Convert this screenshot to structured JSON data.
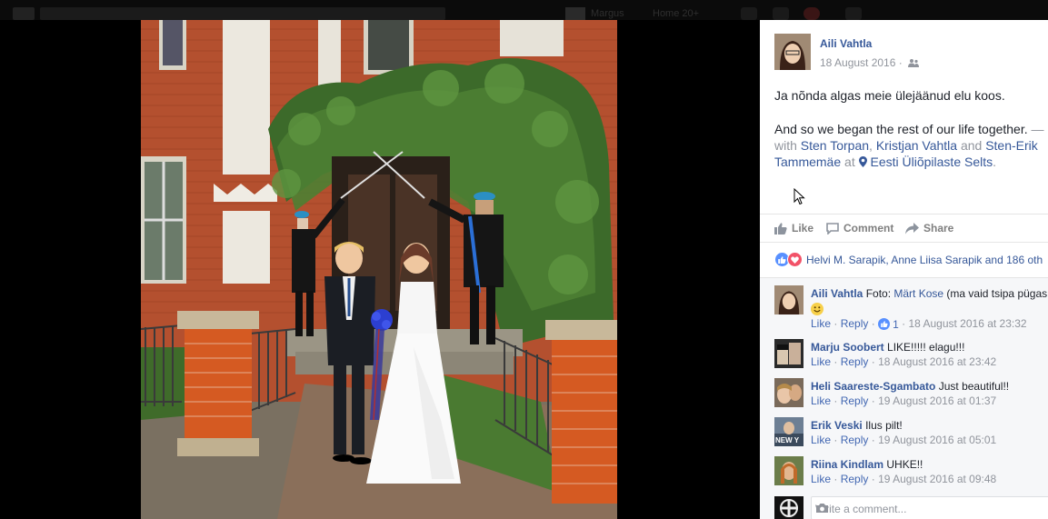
{
  "topbar": {
    "nav": [
      "Margus",
      "Home 20+"
    ]
  },
  "post": {
    "author": "Aili Vahtla",
    "date": "18 August 2016 ·",
    "text_et": "Ja nõnda algas meie ülejäänud elu koos.",
    "text_en": "And so we began the rest of our life together.",
    "dash": " —",
    "with_word": "with",
    "tagged": [
      "Sten Torpan",
      "Kristjan Vahtla",
      "Sten-Erik Tammemäe"
    ],
    "comma": ",",
    "and_word": "and",
    "at_word": "at",
    "place": "Eesti Üliõpilaste Selts",
    "period": "."
  },
  "actions": {
    "like": "Like",
    "comment": "Comment",
    "share": "Share"
  },
  "reactions": {
    "names": "Helvi M. Sarapik, Anne Liisa Sarapik and 186 oth"
  },
  "comments": [
    {
      "name": "Aili Vahtla",
      "text": "Foto: ",
      "mention": "Märt Kose",
      "text2": " (ma vaid tsipa pügas",
      "like": "Like",
      "reply": "Reply",
      "likes": "1",
      "time": "18 August 2016 at 23:32"
    },
    {
      "name": "Marju Soobert",
      "text": "LIKE!!!!! elagu!!!",
      "like": "Like",
      "reply": "Reply",
      "time": "18 August 2016 at 23:42"
    },
    {
      "name": "Heli Saareste-Sgambato",
      "text": "Just beautiful!!",
      "like": "Like",
      "reply": "Reply",
      "time": "19 August 2016 at 01:37"
    },
    {
      "name": "Erik Veski",
      "text": "Ilus pilt!",
      "like": "Like",
      "reply": "Reply",
      "time": "19 August 2016 at 05:01",
      "avatar_text": "NEW Y"
    },
    {
      "name": "Riina Kindlam",
      "text": "UHKE!!",
      "like": "Like",
      "reply": "Reply",
      "time": "19 August 2016 at 09:48"
    }
  ],
  "write_comment": {
    "placeholder": "Write a comment..."
  },
  "colors": {
    "link": "#365899",
    "like_blue": "#5890ff",
    "love_red": "#f25268"
  }
}
